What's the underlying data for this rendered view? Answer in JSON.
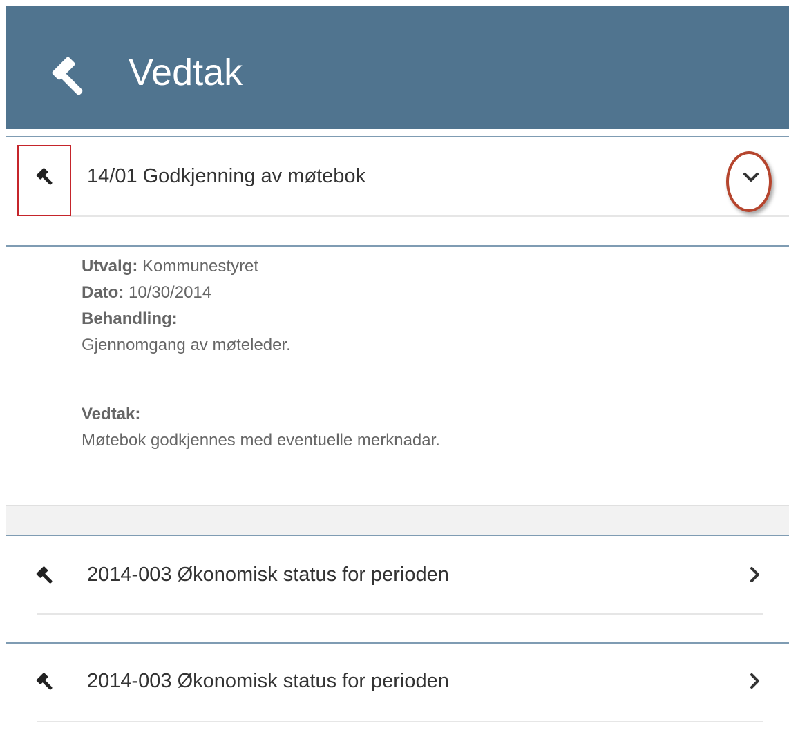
{
  "header": {
    "title": "Vedtak",
    "icon": "gavel-icon",
    "background_color": "#50748f"
  },
  "expanded_item": {
    "title": "14/01 Godkjenning av møtebok",
    "icon": "gavel-icon",
    "toggle_icon": "chevron-down-icon",
    "details": {
      "utvalg_label": "Utvalg:",
      "utvalg_value": "Kommunestyret",
      "dato_label": "Dato:",
      "dato_value": "10/30/2014",
      "behandling_label": "Behandling:",
      "behandling_text": "Gjennomgang av møteleder.",
      "vedtak_label": "Vedtak:",
      "vedtak_text": "Møtebok godkjennes med eventuelle merknadar."
    }
  },
  "items": [
    {
      "title": "2014-003 Økonomisk status for perioden",
      "icon": "gavel-icon",
      "toggle_icon": "chevron-right-icon"
    },
    {
      "title": "2014-003 Økonomisk status for perioden",
      "icon": "gavel-icon",
      "toggle_icon": "chevron-right-icon"
    }
  ],
  "annotation_colors": {
    "box": "#c5252b",
    "ring": "#b5452e"
  }
}
